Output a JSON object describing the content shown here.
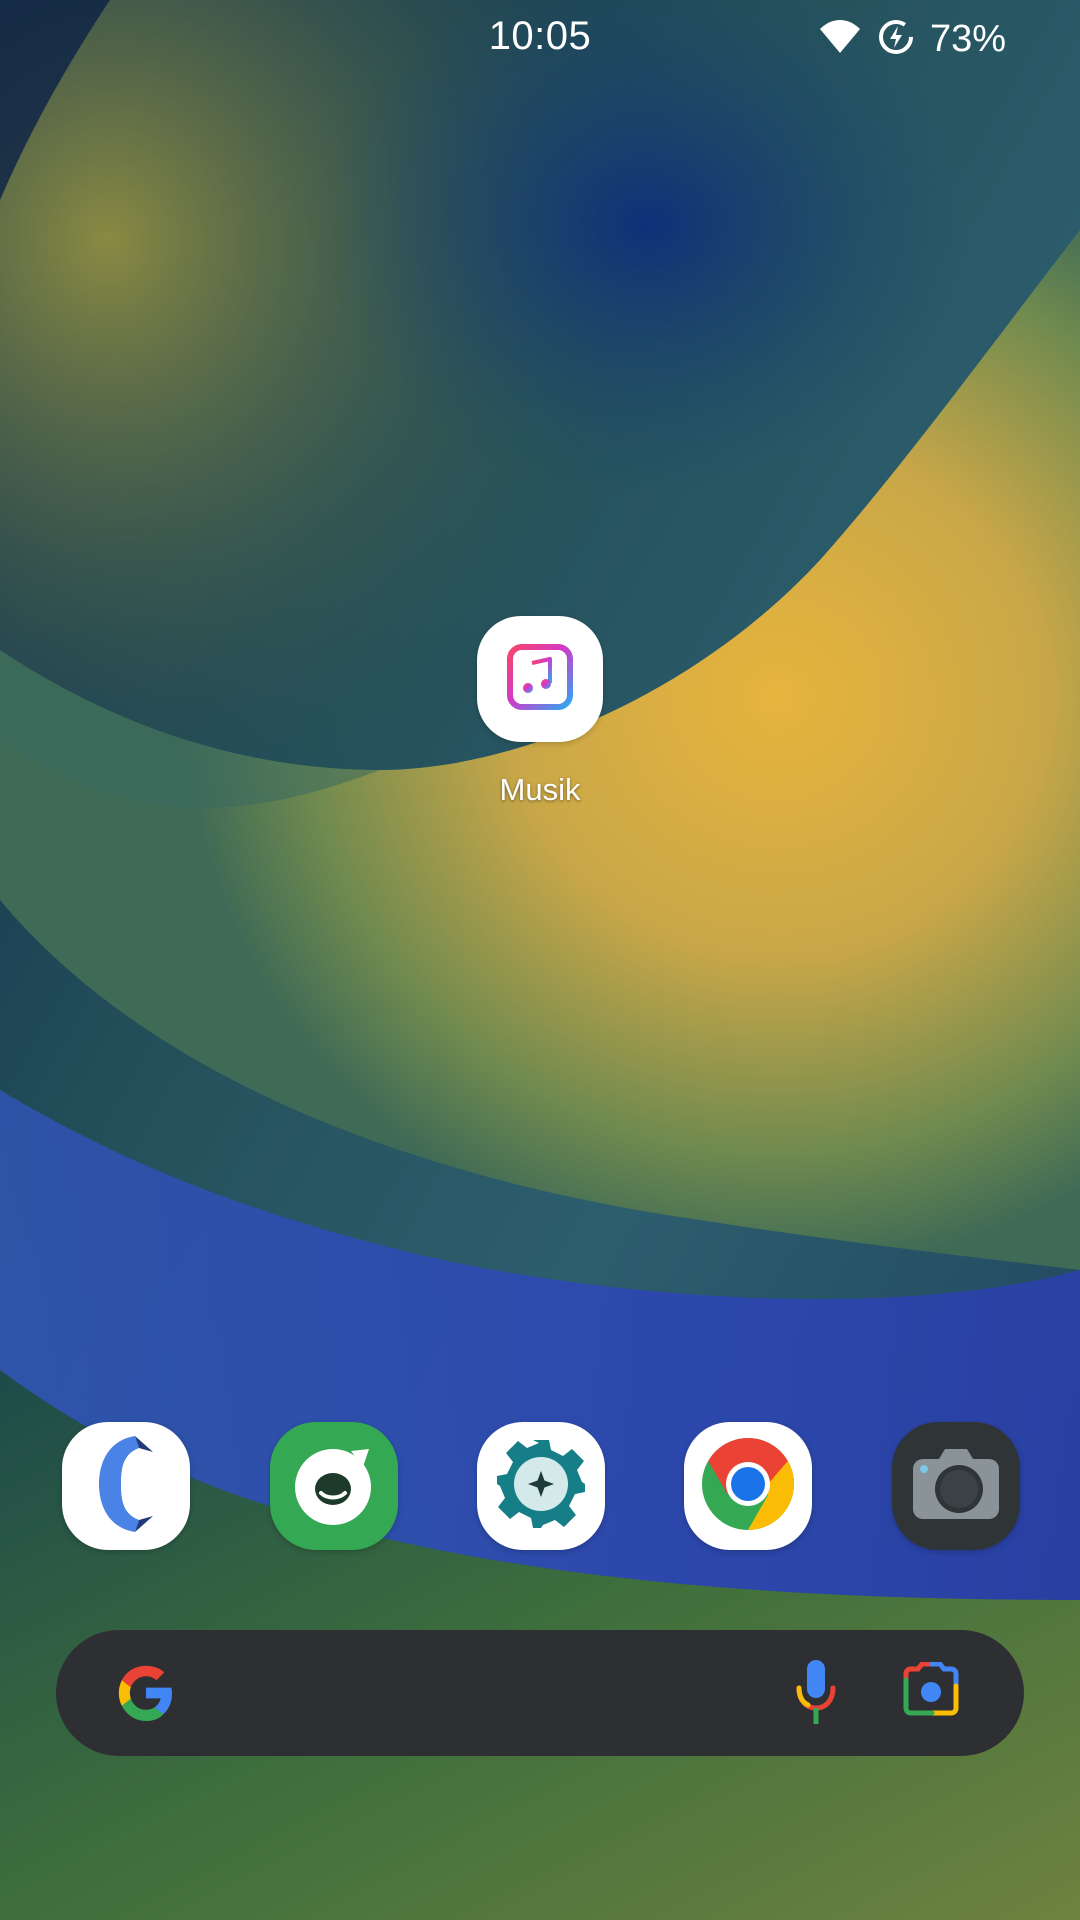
{
  "status_bar": {
    "time": "10:05",
    "battery_percent": "73%",
    "icons": [
      "wifi-icon",
      "battery-saver-icon"
    ]
  },
  "home": {
    "apps": [
      {
        "label": "Musik",
        "icon": "music-icon"
      }
    ]
  },
  "dock": {
    "apps": [
      {
        "icon": "phone-icon"
      },
      {
        "icon": "messenger-icon"
      },
      {
        "icon": "settings-icon"
      },
      {
        "icon": "chrome-icon"
      },
      {
        "icon": "camera-icon"
      }
    ]
  },
  "search_bar": {
    "icons": [
      "google-logo-icon",
      "microphone-icon",
      "google-lens-icon"
    ]
  },
  "colors": {
    "search_bar_bg": "#2e2f33",
    "messenger_green": "#34a853",
    "camera_bg": "#2f3437"
  }
}
